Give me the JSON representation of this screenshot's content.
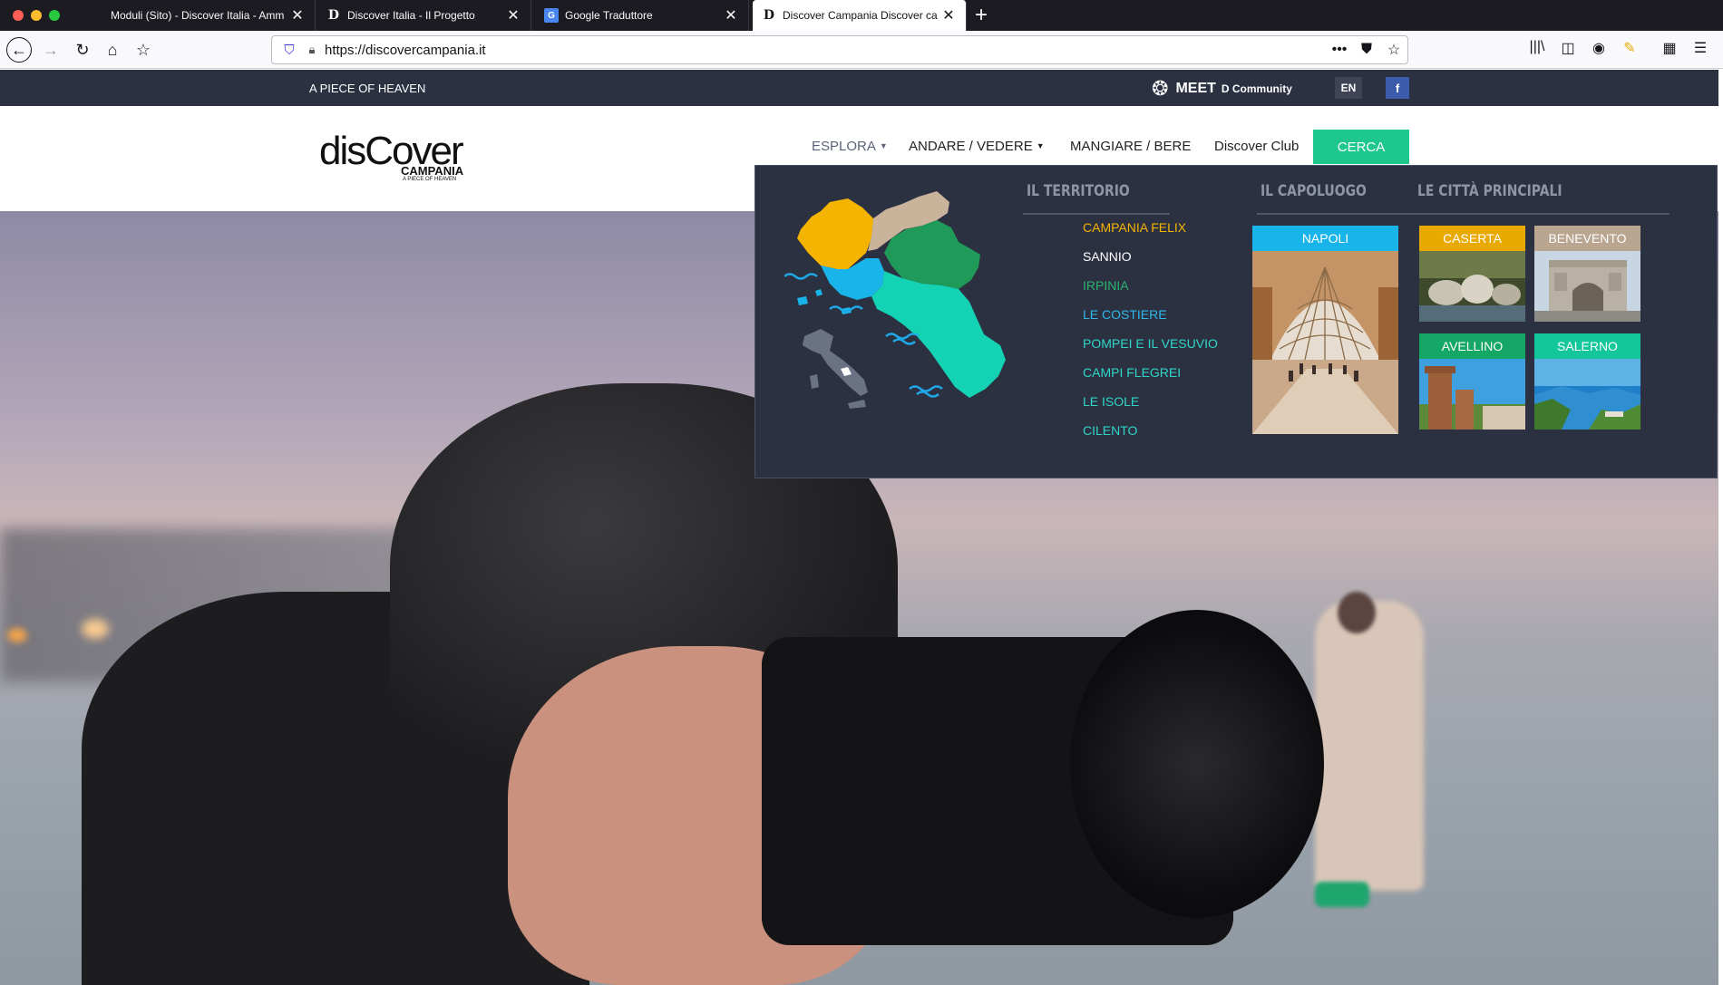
{
  "browser": {
    "tabs": [
      {
        "label": "Moduli (Sito) - Discover Italia - Amm",
        "favicon": "none"
      },
      {
        "label": "Discover Italia - Il Progetto",
        "favicon": "D"
      },
      {
        "label": "Google Traduttore",
        "favicon": "G"
      },
      {
        "label": "Discover Campania Discover ca",
        "favicon": "D",
        "active": true
      }
    ],
    "url": "https://discovercampania.it"
  },
  "topbar": {
    "tagline": "A PIECE OF HEAVEN",
    "meet": "MEET",
    "meet_sub": "D Community",
    "lang": "EN",
    "facebook": "f"
  },
  "header": {
    "logo_main": "disCover",
    "logo_sub": "CAMPANIA",
    "logo_tag": "A PIECE OF HEAVEN",
    "menu": [
      {
        "label": "ESPLORA",
        "caret": true,
        "color": "#5b6376"
      },
      {
        "label": "ANDARE / VEDERE",
        "caret": true,
        "color": "#222222"
      },
      {
        "label": "MANGIARE / BERE",
        "caret": false,
        "color": "#222222"
      },
      {
        "label": "Discover Club",
        "caret": false,
        "color": "#222222"
      }
    ],
    "search_button": "CERCA"
  },
  "mega": {
    "territory_heading": "IL TERRITORIO",
    "capital_heading": "IL CAPOLUOGO",
    "cities_heading": "LE CITTÀ PRINCIPALI",
    "regions": [
      {
        "label": "CAMPANIA FELIX",
        "color": "#f5b400"
      },
      {
        "label": "SANNIO",
        "color": "#ffffff"
      },
      {
        "label": "IRPINIA",
        "color": "#2bb570"
      },
      {
        "label": "LE COSTIERE",
        "color": "#2fb8e8"
      },
      {
        "label": "POMPEI E IL VESUVIO",
        "color": "#2fd6c8"
      },
      {
        "label": "CAMPI FLEGREI",
        "color": "#2fd6c8"
      },
      {
        "label": "LE ISOLE",
        "color": "#2fd6c8"
      },
      {
        "label": "CILENTO",
        "color": "#2fd6c8"
      }
    ],
    "capital": {
      "label": "NAPOLI",
      "color": "#18b4ea"
    },
    "cities": [
      {
        "label": "CASERTA",
        "color": "#e8a900"
      },
      {
        "label": "BENEVENTO",
        "color": "#b9a590"
      },
      {
        "label": "AVELLINO",
        "color": "#14a765"
      },
      {
        "label": "SALERNO",
        "color": "#14c79a"
      }
    ]
  }
}
